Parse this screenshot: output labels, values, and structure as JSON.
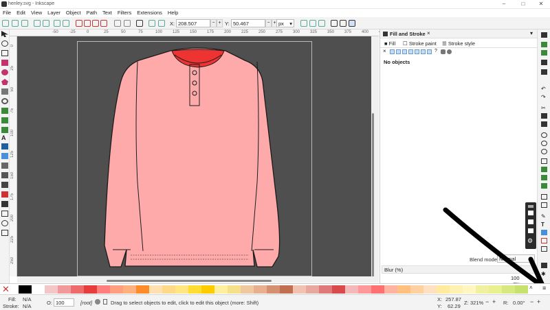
{
  "window": {
    "title": "henley.svg - Inkscape"
  },
  "menu": [
    "File",
    "Edit",
    "View",
    "Layer",
    "Object",
    "Path",
    "Text",
    "Filters",
    "Extensions",
    "Help"
  ],
  "toolbar": {
    "x_label": "X:",
    "x_value": "208.507",
    "y_label": "Y:",
    "y_value": "50.467",
    "unit": "px"
  },
  "ruler": {
    "h": [
      "-50",
      "-25",
      "0",
      "25",
      "50",
      "75",
      "100",
      "125",
      "150",
      "175",
      "200",
      "225",
      "250",
      "275",
      "300",
      "325",
      "350",
      "375",
      "400",
      "425"
    ],
    "v": [
      "0",
      "25",
      "50",
      "75",
      "100",
      "125",
      "150",
      "175",
      "200",
      "225",
      "250"
    ]
  },
  "dialog": {
    "title": "Fill and Stroke",
    "tabs": [
      "Fill",
      "Stroke paint",
      "Stroke style"
    ],
    "status": "No objects",
    "blend_label": "Blend mode:",
    "blend_value": "Normal",
    "blur_label": "Blur (%)",
    "opacity_value": "100"
  },
  "palette": {
    "colors": [
      "#000000",
      "#ffffff",
      "#f5c6c6",
      "#f29a9a",
      "#ee6b6b",
      "#e83d3d",
      "#ff7f7f",
      "#ff9f7f",
      "#ffb07f",
      "#ff8c2a",
      "#ffe0b0",
      "#ffd98a",
      "#ffe680",
      "#ffdd33",
      "#ffcc00",
      "#fff0a0",
      "#f7e08a",
      "#f0c8a0",
      "#e8b090",
      "#d49070",
      "#c07050",
      "#f2c2b0",
      "#e8a8a0",
      "#e07a7a",
      "#d94a4a",
      "#f4b8b8",
      "#ff9999",
      "#ff7070",
      "#ffb3a0",
      "#ffc080",
      "#ffd0a0",
      "#ffe0c0",
      "#ffeaa0",
      "#fff2b0",
      "#fff6c0",
      "#f0f0a0",
      "#e8f090",
      "#d8e880",
      "#c8e070"
    ]
  },
  "status": {
    "fill_label": "Fill:",
    "fill_value": "N/A",
    "stroke_label": "Stroke:",
    "stroke_value": "N/A",
    "opacity_label": "O:",
    "opacity_value": "100",
    "layer": "[root]",
    "message": "Drag to select objects to edit, click to edit this object (more: Shift)",
    "x_label": "X:",
    "x_value": "257.87",
    "y_label": "Y:",
    "y_value": "62.29",
    "zoom_label": "Z:",
    "zoom_value": "321%",
    "rot_label": "R:",
    "rot_value": "0.00°"
  },
  "colors": {
    "shirt": "#ffaaaa",
    "collar_inner": "#ee3333",
    "canvas": "#4f4f4f"
  }
}
